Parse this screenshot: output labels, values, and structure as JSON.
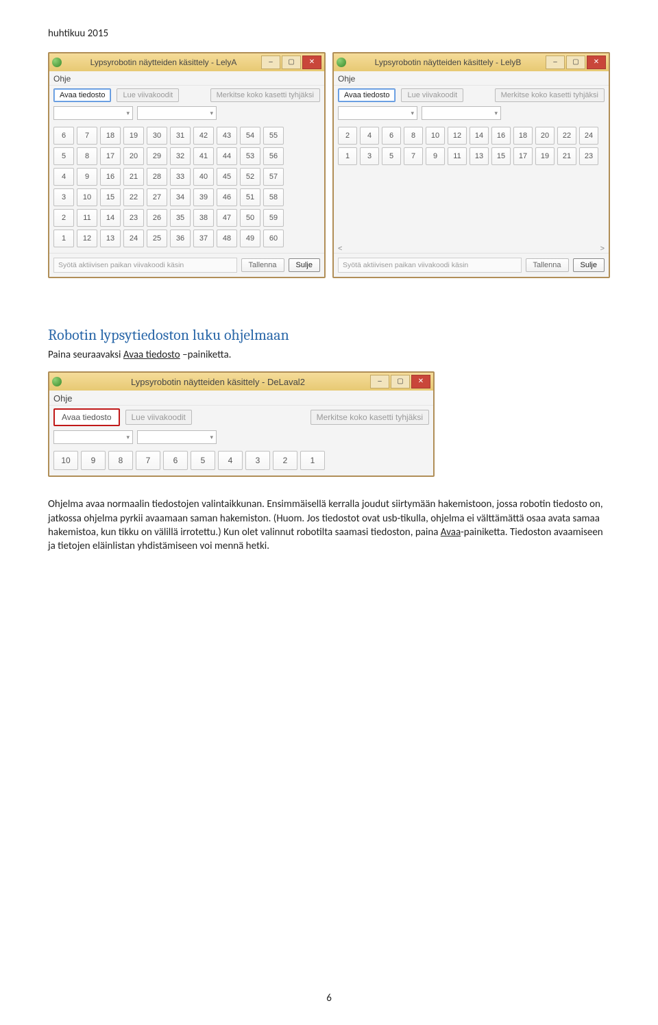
{
  "top_label": "huhtikuu 2015",
  "win_a": {
    "title": "Lypsyrobotin näytteiden käsittely - LelyA",
    "menu_ohje": "Ohje",
    "btn_avaa": "Avaa tiedosto",
    "btn_lue": "Lue viivakoodit",
    "btn_merkitse": "Merkitse koko kasetti tyhjäksi",
    "footer_placeholder": "Syötä aktiivisen paikan viivakoodi käsin",
    "btn_tallenna": "Tallenna",
    "btn_sulje": "Sulje",
    "grid": [
      [
        6,
        7,
        18,
        19,
        30,
        31,
        42,
        43,
        54,
        55
      ],
      [
        5,
        8,
        17,
        20,
        29,
        32,
        41,
        44,
        53,
        56
      ],
      [
        4,
        9,
        16,
        21,
        28,
        33,
        40,
        45,
        52,
        57
      ],
      [
        3,
        10,
        15,
        22,
        27,
        34,
        39,
        46,
        51,
        58
      ],
      [
        2,
        11,
        14,
        23,
        26,
        35,
        38,
        47,
        50,
        59
      ],
      [
        1,
        12,
        13,
        24,
        25,
        36,
        37,
        48,
        49,
        60
      ]
    ]
  },
  "win_b": {
    "title": "Lypsyrobotin näytteiden käsittely - LelyB",
    "menu_ohje": "Ohje",
    "btn_avaa": "Avaa tiedosto",
    "btn_lue": "Lue viivakoodit",
    "btn_merkitse": "Merkitse koko kasetti tyhjäksi",
    "footer_placeholder": "Syötä aktiivisen paikan viivakoodi käsin",
    "btn_tallenna": "Tallenna",
    "btn_sulje": "Sulje",
    "scroll_left": "<",
    "scroll_right": ">",
    "grid": [
      [
        2,
        4,
        6,
        8,
        10,
        12,
        14,
        16,
        18,
        20,
        22,
        24
      ],
      [
        1,
        3,
        5,
        7,
        9,
        11,
        13,
        15,
        17,
        19,
        21,
        23
      ]
    ]
  },
  "section_heading": "Robotin lypsytiedoston luku ohjelmaan",
  "para1_a": "Paina seuraavaksi ",
  "para1_link": "Avaa tiedosto",
  "para1_b": " –painiketta.",
  "win_c": {
    "title": "Lypsyrobotin näytteiden käsittely - DeLaval2",
    "menu_ohje": "Ohje",
    "btn_avaa": "Avaa tiedosto",
    "btn_lue": "Lue viivakoodit",
    "btn_merkitse": "Merkitse koko kasetti tyhjäksi",
    "grid_row": [
      10,
      9,
      8,
      7,
      6,
      5,
      4,
      3,
      2,
      1
    ]
  },
  "para2": "Ohjelma avaa normaalin tiedostojen valintaikkunan. Ensimmäisellä kerralla joudut siirtymään hakemistoon, jossa robotin tiedosto on, jatkossa ohjelma pyrkii avaamaan saman hakemiston. (Huom. Jos tiedostot ovat usb-tikulla, ohjelma ei välttämättä osaa avata samaa hakemistoa, kun tikku on välillä irrotettu.) Kun olet valinnut robotilta saamasi tiedoston, paina ",
  "para2_link": "Avaa",
  "para2_b": "-painiketta. Tiedoston avaamiseen ja tietojen eläinlistan yhdistämiseen voi mennä hetki.",
  "page_number": "6"
}
